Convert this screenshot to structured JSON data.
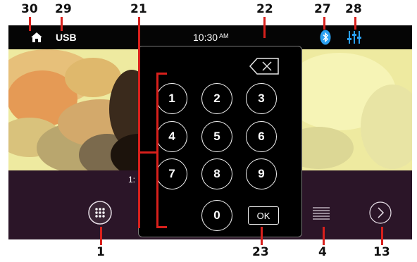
{
  "callouts": [
    "30",
    "29",
    "21",
    "22",
    "27",
    "28",
    "1",
    "23",
    "4",
    "13"
  ],
  "statusbar": {
    "home_icon": "home-icon",
    "source": "USB",
    "time": "10:30",
    "ampm": "AM",
    "bluetooth_icon": "bluetooth-icon",
    "eq_icon": "equalizer-icon"
  },
  "player": {
    "time_fragment": "1:",
    "apps_icon": "grid-icon",
    "list_icon": "list-icon",
    "next_icon": "chevron-right-icon"
  },
  "keypad": {
    "keys": [
      "1",
      "2",
      "3",
      "4",
      "5",
      "6",
      "7",
      "8",
      "9",
      "0"
    ],
    "ok_label": "OK",
    "backspace_icon": "backspace-icon"
  },
  "colors": {
    "callout_red": "#d9201c",
    "accent_blue": "#2aa0f0"
  }
}
